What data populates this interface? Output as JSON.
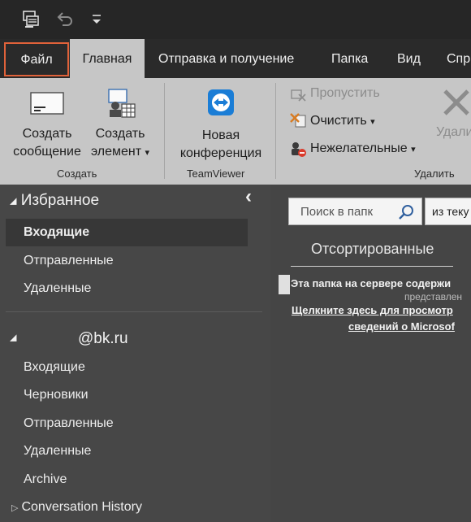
{
  "quick_access": {
    "icons": [
      "send-receive-icon",
      "undo-icon",
      "customize-dropdown-icon"
    ]
  },
  "tabs": [
    {
      "label": "Файл"
    },
    {
      "label": "Главная"
    },
    {
      "label": "Отправка и получение"
    },
    {
      "label": "Папка"
    },
    {
      "label": "Вид"
    },
    {
      "label": "Спр"
    }
  ],
  "ribbon": {
    "create": {
      "new_message_l1": "Создать",
      "new_message_l2": "сообщение",
      "new_item_l1": "Создать",
      "new_item_l2": "элемент",
      "new_item_arrow": "▾",
      "group_label": "Создать"
    },
    "teamviewer": {
      "meeting_l1": "Новая",
      "meeting_l2": "конференция",
      "group_label": "TeamViewer"
    },
    "delete": {
      "ignore": "Пропустить",
      "clean_up": "Очистить",
      "clean_up_arrow": "▾",
      "junk": "Нежелательные",
      "junk_arrow": "▾",
      "delete_label": "Удали",
      "group_label": "Удалить"
    }
  },
  "nav": {
    "favorites_title": "Избранное",
    "collapse_glyph": "‹",
    "favorites": [
      {
        "label": "Входящие"
      },
      {
        "label": "Отправленные"
      },
      {
        "label": "Удаленные"
      }
    ],
    "account_title": "@bk.ru",
    "account_folders": [
      {
        "label": "Входящие"
      },
      {
        "label": "Черновики"
      },
      {
        "label": "Отправленные"
      },
      {
        "label": "Удаленные"
      },
      {
        "label": "Archive"
      },
      {
        "label": "Conversation History"
      }
    ]
  },
  "pane": {
    "search_placeholder": "Поиск в папк",
    "scope_label": "из теку",
    "sorted_tab": "Отсортированные",
    "notice_line1": "Эта папка на сервере содержи",
    "notice_line2": "представлен",
    "link_line1": "Щелкните здесь для просмотр",
    "link_line2": "сведений о Microsof"
  },
  "colors": {
    "accent_file_border": "#e0623a",
    "ribbon_bg": "#c6c6c6",
    "nav_bg": "#474747"
  }
}
